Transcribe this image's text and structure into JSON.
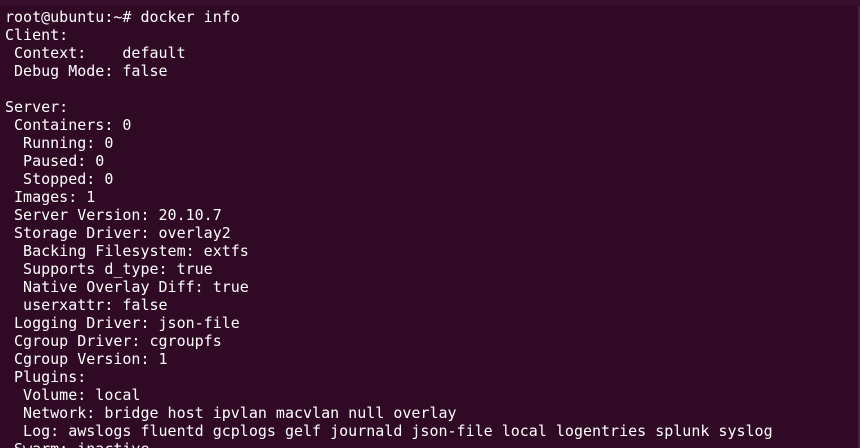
{
  "terminal": {
    "lines": [
      "root@ubuntu:~# docker info",
      "Client:",
      " Context:    default",
      " Debug Mode: false",
      "",
      "Server:",
      " Containers: 0",
      "  Running: 0",
      "  Paused: 0",
      "  Stopped: 0",
      " Images: 1",
      " Server Version: 20.10.7",
      " Storage Driver: overlay2",
      "  Backing Filesystem: extfs",
      "  Supports d_type: true",
      "  Native Overlay Diff: true",
      "  userxattr: false",
      " Logging Driver: json-file",
      " Cgroup Driver: cgroupfs",
      " Cgroup Version: 1",
      " Plugins:",
      "  Volume: local",
      "  Network: bridge host ipvlan macvlan null overlay",
      "  Log: awslogs fluentd gcplogs gelf journald json-file local logentries splunk syslog",
      " Swarm: inactive"
    ]
  }
}
